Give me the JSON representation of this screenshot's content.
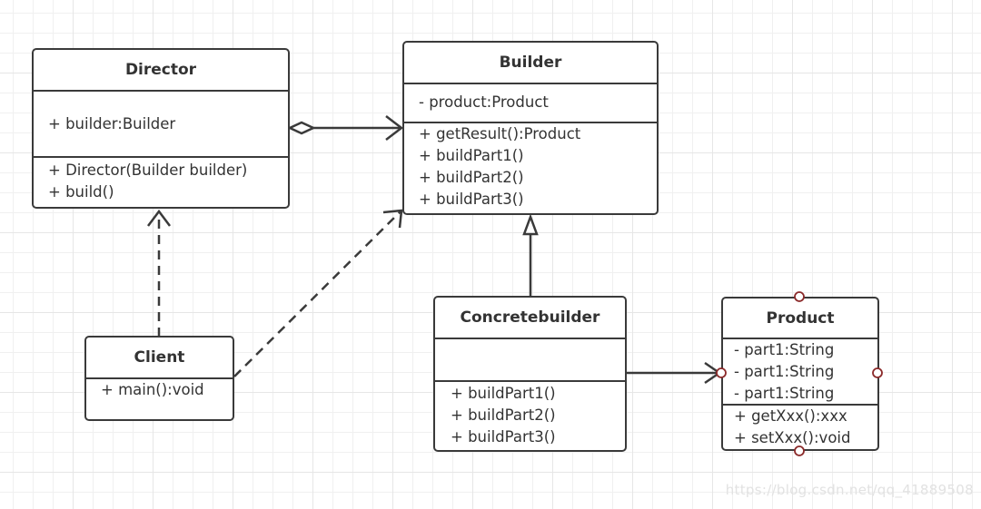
{
  "diagram": {
    "type": "UML class diagram",
    "pattern": "Builder",
    "classes": {
      "director": {
        "name": "Director",
        "attributes": [
          "+ builder:Builder"
        ],
        "methods": [
          "+ Director(Builder builder)",
          "+ build()"
        ]
      },
      "builder": {
        "name": "Builder",
        "attributes": [
          "- product:Product"
        ],
        "methods": [
          "+ getResult():Product",
          "+ buildPart1()",
          "+ buildPart2()",
          "+ buildPart3()"
        ]
      },
      "client": {
        "name": "Client",
        "attributes": [],
        "methods": [
          "+ main():void"
        ]
      },
      "concretebuilder": {
        "name": "Concretebuilder",
        "attributes": [],
        "methods": [
          "+ buildPart1()",
          "+ buildPart2()",
          "+ buildPart3()"
        ]
      },
      "product": {
        "name": "Product",
        "attributes": [
          "- part1:String",
          "- part1:String",
          "- part1:String"
        ],
        "methods": [
          "+ getXxx():xxx",
          "+ setXxx():void"
        ]
      }
    },
    "relationships": [
      {
        "from": "Director",
        "to": "Builder",
        "kind": "aggregation"
      },
      {
        "from": "Client",
        "to": "Director",
        "kind": "dependency"
      },
      {
        "from": "Client",
        "to": "Builder",
        "kind": "dependency"
      },
      {
        "from": "Concretebuilder",
        "to": "Builder",
        "kind": "generalization"
      },
      {
        "from": "Concretebuilder",
        "to": "Product",
        "kind": "association"
      }
    ],
    "colors": {
      "stroke": "#3a3a3a",
      "connection_point": "#8b2a2a",
      "grid": "#e6e6e6"
    }
  },
  "watermark": "https://blog.csdn.net/qq_41889508"
}
